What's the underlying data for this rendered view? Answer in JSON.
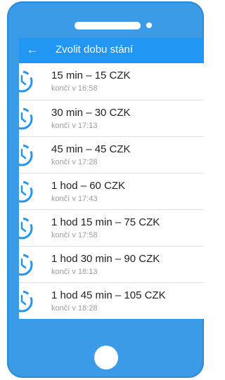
{
  "appbar": {
    "back_icon": "←",
    "title": "Zvolit dobu stání"
  },
  "options": [
    {
      "title": "15 min – 15 CZK",
      "subtitle": "končí v 16:58",
      "icon": "clock-icon"
    },
    {
      "title": "30 min – 30 CZK",
      "subtitle": "končí v 17:13",
      "icon": "clock-icon"
    },
    {
      "title": "45 min – 45 CZK",
      "subtitle": "končí v 17:28",
      "icon": "clock-icon"
    },
    {
      "title": "1 hod – 60 CZK",
      "subtitle": "končí v 17:43",
      "icon": "clock-icon"
    },
    {
      "title": "1 hod 15 min – 75 CZK",
      "subtitle": "končí v 17:58",
      "icon": "clock-icon"
    },
    {
      "title": "1 hod 30 min – 90 CZK",
      "subtitle": "končí v 18:13",
      "icon": "clock-icon"
    },
    {
      "title": "1 hod 45 min – 105 CZK",
      "subtitle": "končí v 18:28",
      "icon": "clock-icon"
    }
  ],
  "colors": {
    "phone_body": "#3b9be6",
    "appbar": "#2196f3",
    "icon": "#2196f3",
    "title_text": "#212121",
    "subtitle_text": "#9e9e9e"
  }
}
